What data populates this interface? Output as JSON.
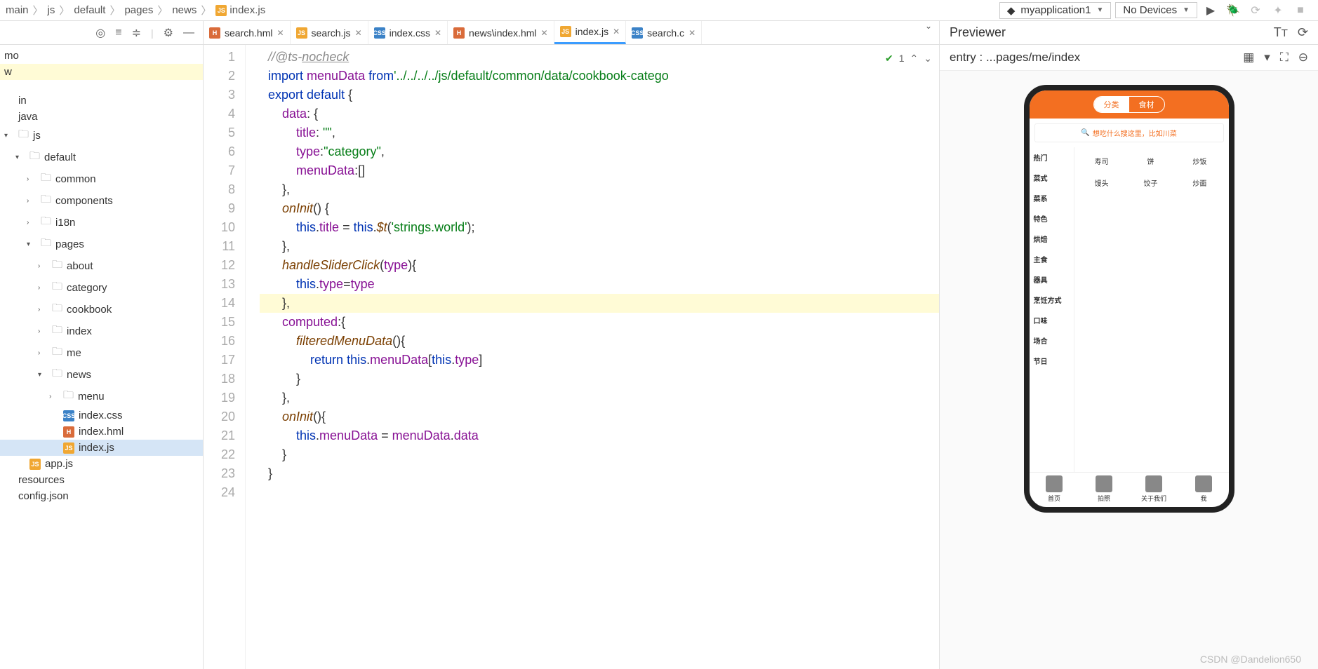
{
  "breadcrumbs": [
    "main",
    "js",
    "default",
    "pages",
    "news",
    "index.js"
  ],
  "toolbar": {
    "project_dd": "myapplication1",
    "devices_dd": "No Devices"
  },
  "tabs": [
    {
      "label": "search.hml",
      "type": "hml",
      "active": false
    },
    {
      "label": "search.js",
      "type": "js",
      "active": false
    },
    {
      "label": "index.css",
      "type": "css",
      "active": false
    },
    {
      "label": "news\\index.hml",
      "type": "hml",
      "active": false
    },
    {
      "label": "index.js",
      "type": "js",
      "active": true
    },
    {
      "label": "search.c",
      "type": "css",
      "active": false,
      "truncated": true
    }
  ],
  "previewer_title": "Previewer",
  "project_tree_top": "mo",
  "project_tree_row": "w",
  "project_tree": {
    "items": [
      {
        "label": "in",
        "indent": 0
      },
      {
        "label": "java",
        "indent": 0
      },
      {
        "label": "js",
        "indent": 0,
        "folder": true,
        "chev": "▾"
      },
      {
        "label": "default",
        "indent": 1,
        "folder": true,
        "chev": "▾"
      },
      {
        "label": "common",
        "indent": 2,
        "folder": true,
        "chev": "›"
      },
      {
        "label": "components",
        "indent": 2,
        "folder": true,
        "chev": "›"
      },
      {
        "label": "i18n",
        "indent": 2,
        "folder": true,
        "chev": "›"
      },
      {
        "label": "pages",
        "indent": 2,
        "folder": true,
        "chev": "▾"
      },
      {
        "label": "about",
        "indent": 3,
        "folder": true,
        "chev": "›"
      },
      {
        "label": "category",
        "indent": 3,
        "folder": true,
        "chev": "›"
      },
      {
        "label": "cookbook",
        "indent": 3,
        "folder": true,
        "chev": "›"
      },
      {
        "label": "index",
        "indent": 3,
        "folder": true,
        "chev": "›"
      },
      {
        "label": "me",
        "indent": 3,
        "folder": true,
        "chev": "›"
      },
      {
        "label": "news",
        "indent": 3,
        "folder": true,
        "chev": "▾"
      },
      {
        "label": "menu",
        "indent": 4,
        "folder": true,
        "chev": "›"
      },
      {
        "label": "index.css",
        "indent": 4,
        "file": "css"
      },
      {
        "label": "index.hml",
        "indent": 4,
        "file": "hml"
      },
      {
        "label": "index.js",
        "indent": 4,
        "file": "js",
        "selected": true
      },
      {
        "label": "app.js",
        "indent": 1,
        "file": "js"
      },
      {
        "label": "resources",
        "indent": 0
      },
      {
        "label": "config.json",
        "indent": 0
      }
    ]
  },
  "editor": {
    "problems_badge": "1",
    "lines": [
      {
        "n": 1,
        "html": "<span class='cmt'>//@ts-<u>nocheck</u></span>"
      },
      {
        "n": 2,
        "html": "<span class='kw'>import</span> <span class='id'>menuData</span> <span class='kw'>from</span><span class='str'>'../../../../js/default/common/data/cookbook-catego</span>"
      },
      {
        "n": 3,
        "html": "<span class='kw'>export default</span> {"
      },
      {
        "n": 4,
        "html": "    <span class='prop'>data</span>: {"
      },
      {
        "n": 5,
        "html": "        <span class='prop'>title</span>: <span class='str'>\"\"</span>,"
      },
      {
        "n": 6,
        "html": "        <span class='prop'>type</span>:<span class='str'>\"category\"</span>,"
      },
      {
        "n": 7,
        "html": "        <span class='prop'>menuData</span>:[]"
      },
      {
        "n": 8,
        "html": "    },"
      },
      {
        "n": 9,
        "html": "    <span class='fn'>onInit</span>() {"
      },
      {
        "n": 10,
        "html": "        <span class='this'>this</span>.<span class='id'>title</span> = <span class='this'>this</span>.<span class='fn'>$t</span>(<span class='str'>'strings.world'</span>);"
      },
      {
        "n": 11,
        "html": "    },"
      },
      {
        "n": 12,
        "html": "    <span class='fn'>handleSliderClick</span>(<span class='id'>type</span>){"
      },
      {
        "n": 13,
        "html": "        <span class='this'>this</span>.<span class='id'>type</span>=<span class='id'>type</span>"
      },
      {
        "n": 14,
        "html": "    },",
        "hl": true
      },
      {
        "n": 15,
        "html": "    <span class='prop'>computed</span>:{"
      },
      {
        "n": 16,
        "html": "        <span class='fn'>filteredMenuData</span>(){"
      },
      {
        "n": 17,
        "html": "            <span class='kw'>return</span> <span class='this'>this</span>.<span class='id'>menuData</span>[<span class='this'>this</span>.<span class='id'>type</span>]"
      },
      {
        "n": 18,
        "html": "        }"
      },
      {
        "n": 19,
        "html": "    },"
      },
      {
        "n": 20,
        "html": "    <span class='fn'>onInit</span>(){"
      },
      {
        "n": 21,
        "html": "        <span class='this'>this</span>.<span class='id'>menuData</span> = <span class='id'>menuData</span>.<span class='id'>data</span>"
      },
      {
        "n": 22,
        "html": "    }"
      },
      {
        "n": 23,
        "html": "}"
      },
      {
        "n": 24,
        "html": ""
      }
    ]
  },
  "preview": {
    "entry_label": "entry : ...pages/me/index",
    "pills": [
      "分类",
      "食材"
    ],
    "search_placeholder": "想吃什么搜这里，比如川菜",
    "side": [
      "热门",
      "菜式",
      "菜系",
      "特色",
      "烘焙",
      "主食",
      "器具",
      "烹饪方式",
      "口味",
      "场合",
      "节日"
    ],
    "grid": [
      "寿司",
      "饼",
      "炒饭",
      "馒头",
      "饺子",
      "炒面"
    ],
    "nav": [
      "首页",
      "拍照",
      "关于我们",
      "我"
    ]
  },
  "watermark": "CSDN @Dandelion650"
}
